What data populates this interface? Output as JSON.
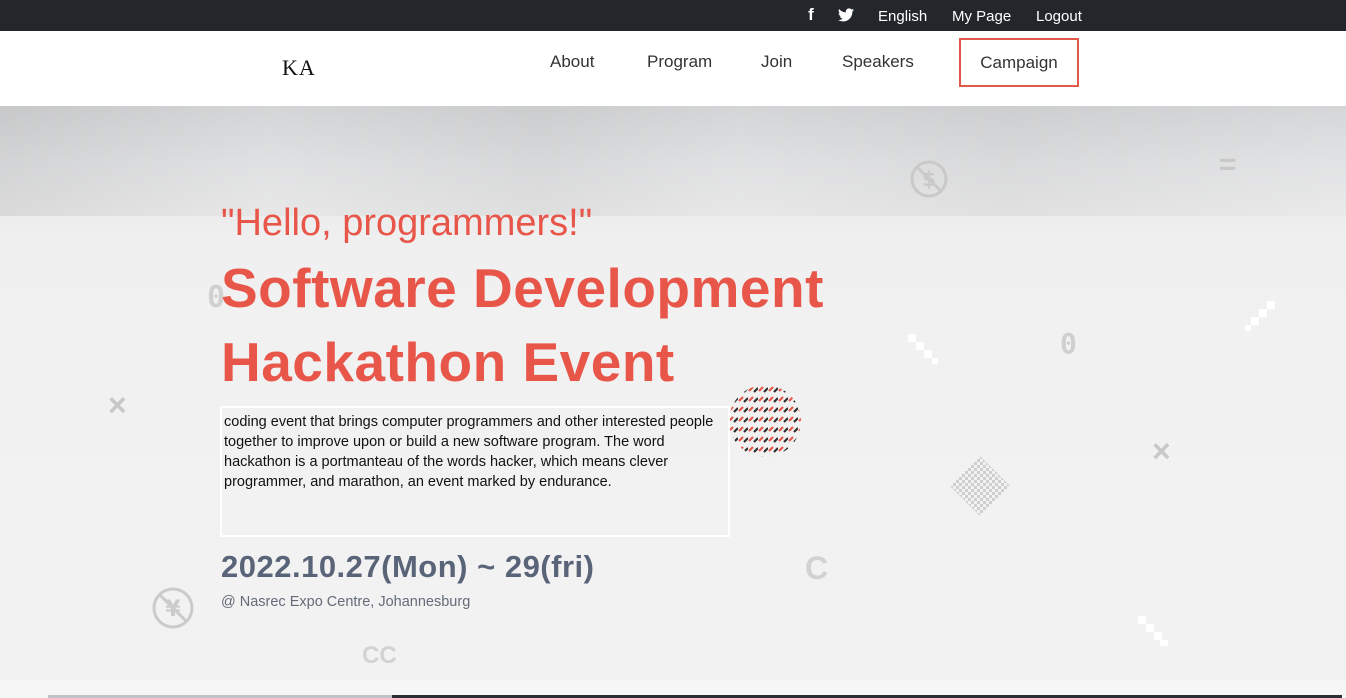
{
  "topbar": {
    "facebook_icon": "facebook-icon",
    "twitter_icon": "twitter-icon",
    "language": "English",
    "my_page": "My Page",
    "logout": "Logout"
  },
  "navbar": {
    "logo": "KA",
    "items": [
      "About",
      "Program",
      "Join",
      "Speakers",
      "Campaign"
    ]
  },
  "hero": {
    "greeting": "\"Hello, programmers!\"",
    "title_line1": "Software Development",
    "title_line2": "Hackathon Event",
    "description": "coding event that brings computer programmers and other interested people together to improve upon or build a new software program. The word hackathon is a portmanteau of the words hacker, which means clever programmer, and marathon, an event marked by endurance.",
    "dates": "2022.10.27(Mon) ~ 29(fri)",
    "venue": "@ Nasrec Expo Centre, Johannesburg"
  },
  "decorations": {
    "dollar": "$",
    "yen": "¥",
    "equals": "=",
    "zero_left": "0",
    "zero_right": "0",
    "times_left": "×",
    "times_right": "×",
    "letter_c": "C",
    "letters_cc": "CC"
  },
  "colors": {
    "accent": "#e8564a",
    "topbar_bg": "#23262b",
    "date_text": "#5a6478"
  }
}
